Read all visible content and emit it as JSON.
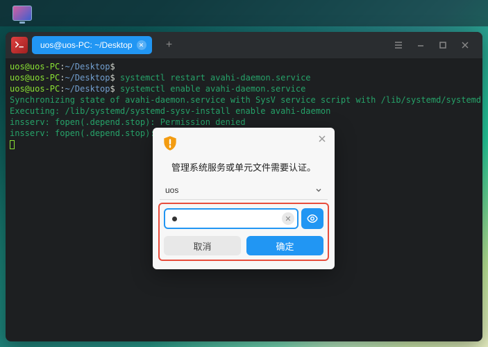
{
  "tab": {
    "title": "uos@uos-PC: ~/Desktop"
  },
  "prompt": {
    "user": "uos@uos-PC",
    "sep": ":",
    "path": "~/Desktop",
    "dollar": "$"
  },
  "cmd1": "systemctl restart avahi-daemon.service",
  "cmd2": "systemctl enable avahi-daemon.service",
  "out1": "Synchronizing state of avahi-daemon.service with SysV service script with /lib/systemd/systemd-sysv-install.",
  "out2": "Executing: /lib/systemd/systemd-sysv-install enable avahi-daemon",
  "out3": "insserv: fopen(.depend.stop): Permission denied",
  "out4": "insserv: fopen(.depend.stop): Permission denied",
  "dialog": {
    "title": "管理系统服务或单元文件需要认证。",
    "user": "uos",
    "cancel": "取消",
    "ok": "确定"
  }
}
